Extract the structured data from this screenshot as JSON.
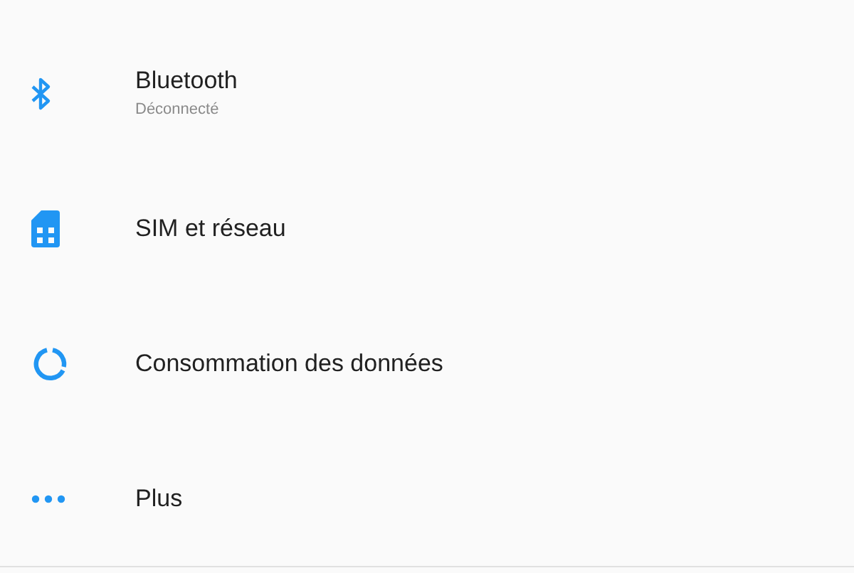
{
  "settings_items": [
    {
      "title": "Bluetooth",
      "subtitle": "Déconnecté"
    },
    {
      "title": "SIM et réseau"
    },
    {
      "title": "Consommation des données"
    },
    {
      "title": "Plus"
    }
  ]
}
